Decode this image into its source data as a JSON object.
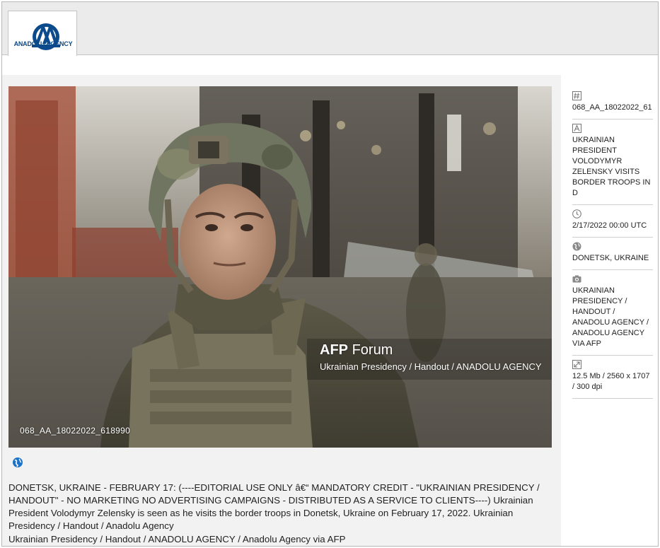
{
  "brand": {
    "name": "ANADOLU AGENCY",
    "logo_mark": "AA"
  },
  "photo": {
    "watermark_brand": "AFP",
    "watermark_product": "Forum",
    "watermark_credit": "Ukrainian Presidency / Handout / ANADOLU AGENCY",
    "id_label": "068_AA_18022022_618990"
  },
  "caption": {
    "text": "DONETSK, UKRAINE - FEBRUARY 17: (----EDITORIAL USE ONLY â€“ MANDATORY CREDIT - \"UKRAINIAN PRESIDENCY / HANDOUT\" - NO MARKETING NO ADVERTISING CAMPAIGNS - DISTRIBUTED AS A SERVICE TO CLIENTS----) Ukrainian President Volodymyr Zelensky is seen as he visits the border troops in Donetsk, Ukraine on February 17, 2022. Ukrainian Presidency / Handout / Anadolu Agency",
    "credit": "Ukrainian Presidency / Handout / ANADOLU AGENCY / Anadolu Agency via AFP"
  },
  "meta": {
    "id": {
      "icon": "hash-icon",
      "value": "068_AA_18022022_61"
    },
    "title": {
      "icon": "text-icon",
      "value": "UKRAINIAN PRESIDENT VOLODYMYR ZELENSKY VISITS BORDER TROOPS IN D"
    },
    "date": {
      "icon": "clock-icon",
      "value": "2/17/2022 00:00 UTC"
    },
    "location": {
      "icon": "globe-icon",
      "value": "DONETSK, UKRAINE"
    },
    "credit": {
      "icon": "camera-icon",
      "value": "UKRAINIAN PRESIDENCY / HANDOUT / ANADOLU AGENCY / ANADOLU AGENCY VIA AFP"
    },
    "size": {
      "icon": "resize-icon",
      "value": "12.5 Mb / 2560 x 1707 / 300 dpi"
    }
  },
  "colors": {
    "brand_blue": "#0b4a8b",
    "header_bg": "#ebebeb",
    "panel_bg": "#f2f2f2",
    "globe_blue": "#1d72c9"
  }
}
